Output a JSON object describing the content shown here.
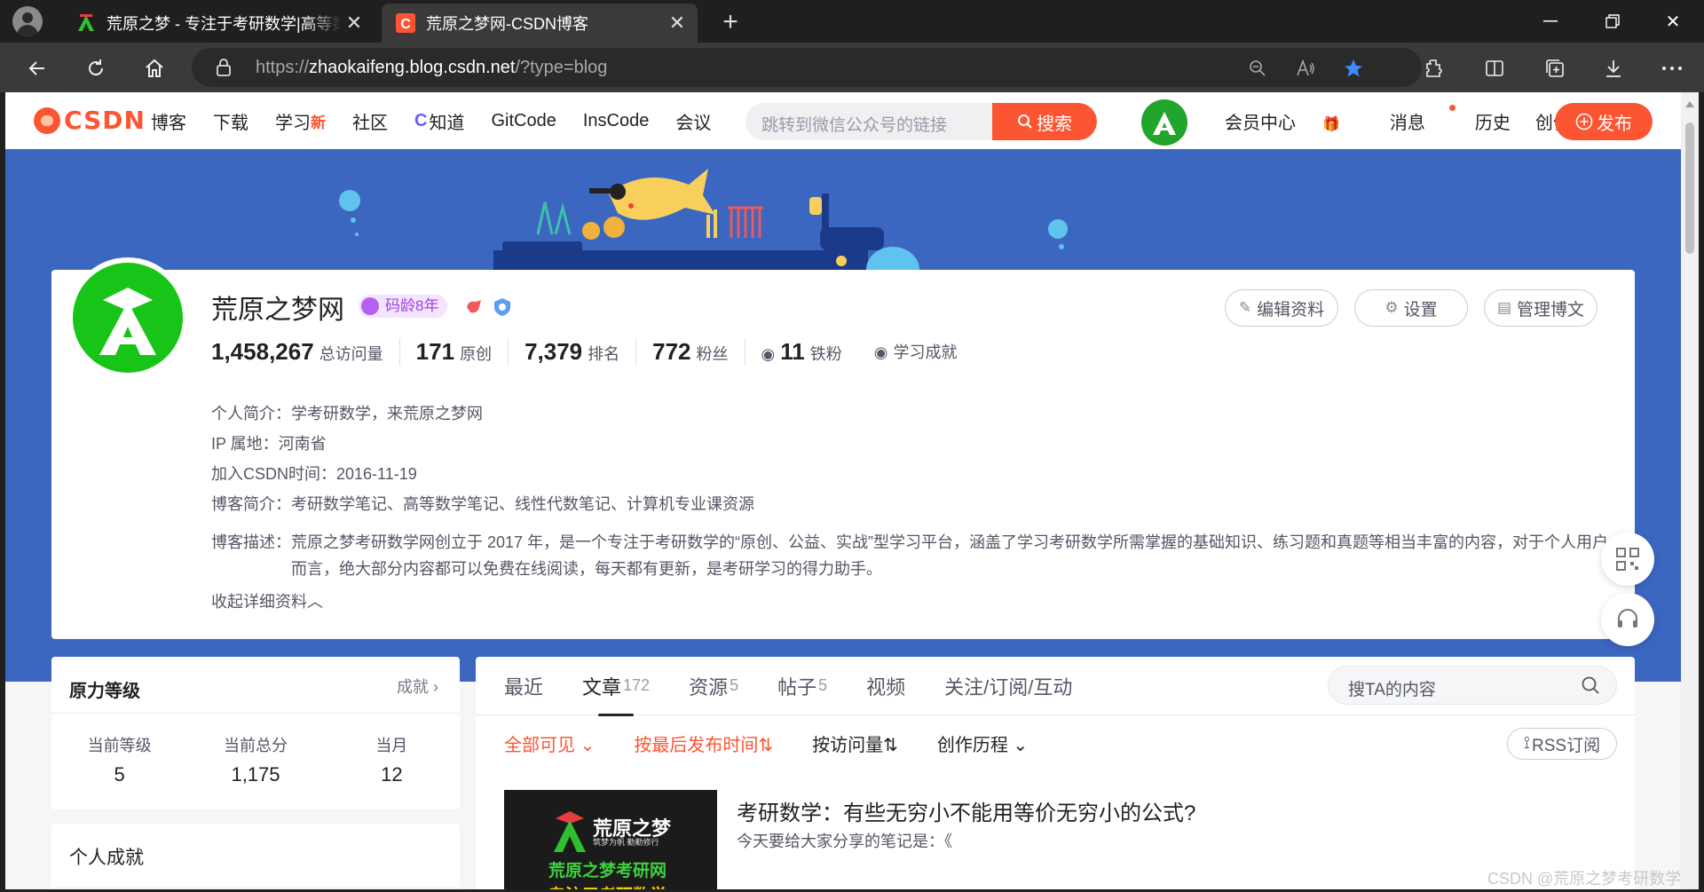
{
  "browser": {
    "tabs": [
      {
        "title": "荒原之梦 - 专注于考研数学|高等数学|线性代数"
      },
      {
        "title": "荒原之梦网-CSDN博客"
      }
    ],
    "url": {
      "prefix": "https://",
      "host": "zhaokaifeng.blog.csdn.net",
      "path": "/?type=blog"
    }
  },
  "csdn": {
    "logo": "CSDN",
    "nav": [
      {
        "label": "博客"
      },
      {
        "label": "下载"
      },
      {
        "label": "学习",
        "badge": "新"
      },
      {
        "label": "社区"
      },
      {
        "label": "知道"
      },
      {
        "label": "GitCode"
      },
      {
        "label": "InsCode"
      },
      {
        "label": "会议"
      }
    ],
    "search": {
      "placeholder": "跳转到微信公众号的链接",
      "button": "搜索"
    },
    "right_nav": [
      "会员中心",
      "消息",
      "历史",
      "创作中心"
    ],
    "publish": "发布"
  },
  "profile": {
    "name": "荒原之梦网",
    "code_age": "码龄8年",
    "buttons": [
      "编辑资料",
      "设置",
      "管理博文"
    ],
    "stats": [
      {
        "num": "1,458,267",
        "label": "总访问量"
      },
      {
        "num": "171",
        "label": "原创"
      },
      {
        "num": "7,379",
        "label": "排名"
      },
      {
        "num": "772",
        "label": "粉丝"
      },
      {
        "num": "11",
        "label": "铁粉"
      }
    ],
    "achievements_link": "学习成就",
    "intro": "个人简介：学考研数学，来荒原之梦网",
    "ip": "IP 属地：河南省",
    "joined": "加入CSDN时间：2016-11-19",
    "blog_brief": "博客简介：考研数学笔记、高等数学笔记、线性代数笔记、计算机专业课资源",
    "blog_desc_key": "博客描述：",
    "blog_desc": "荒原之梦考研数学网创立于 2017 年，是一个专注于考研数学的“原创、公益、实战”型学习平台，涵盖了学习考研数学所需掌握的基础知识、练习题和真题等相当丰富的内容，对于个人用户而言，绝大部分内容都可以免费在线阅读，每天都有更新，是考研学习的得力助手。",
    "collapse": "收起详细资料"
  },
  "level": {
    "title": "原力等级",
    "more": "成就",
    "cols": [
      {
        "k": "当前等级",
        "v": "5"
      },
      {
        "k": "当前总分",
        "v": "1,175"
      },
      {
        "k": "当月",
        "v": "12"
      }
    ]
  },
  "achievements": {
    "title": "个人成就"
  },
  "content": {
    "tabs": [
      {
        "label": "最近",
        "count": ""
      },
      {
        "label": "文章",
        "count": "172"
      },
      {
        "label": "资源",
        "count": "5"
      },
      {
        "label": "帖子",
        "count": "5"
      },
      {
        "label": "视频",
        "count": ""
      },
      {
        "label": "关注/订阅/互动",
        "count": ""
      }
    ],
    "search_placeholder": "搜TA的内容",
    "filters": [
      "全部可见",
      "按最后发布时间",
      "按访问量",
      "创作历程"
    ],
    "rss": "RSS订阅",
    "article": {
      "title": "考研数学：有些无穷小不能用等价无穷小的公式?",
      "summary": "今天要给大家分享的笔记是：《",
      "thumb": {
        "l1": "荒原之梦",
        "l2": "筑梦为帆 勤勤修行",
        "l3": "荒原之梦考研网",
        "l4": "专注于考研数学"
      }
    }
  },
  "watermark": "CSDN @荒原之梦考研数学",
  "colors": {
    "accent": "#fc5531",
    "banner": "#3b67c0",
    "avatar_green": "#18c418"
  }
}
